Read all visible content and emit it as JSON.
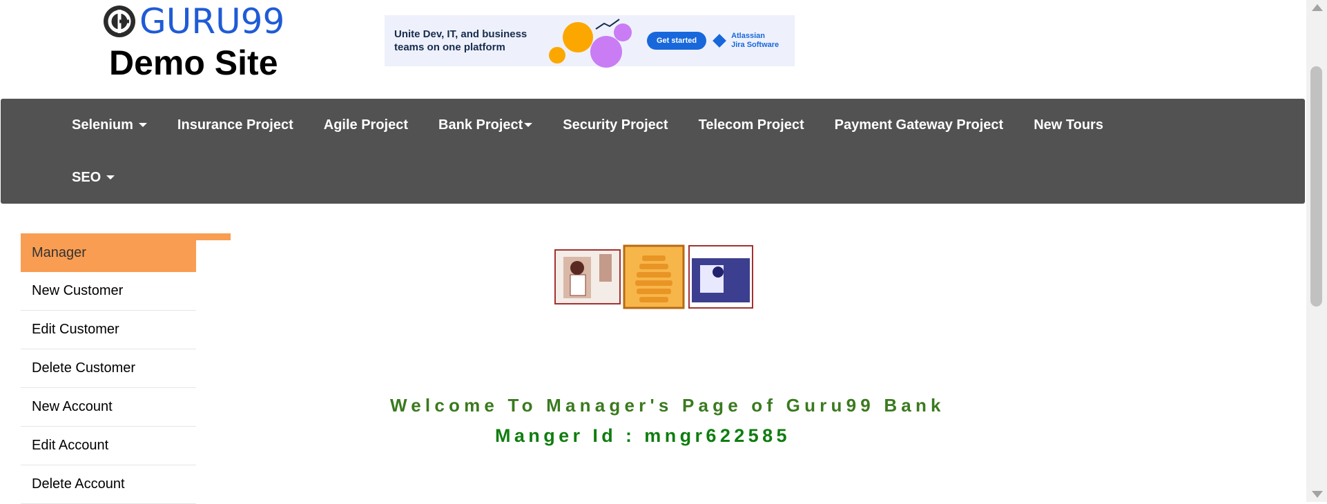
{
  "header": {
    "logo_text": "GURU99",
    "site_title": "Demo Site"
  },
  "ad": {
    "headline": "Unite Dev, IT, and business teams on one platform",
    "button_label": "Get started",
    "brand_line1": "Atlassian",
    "brand_line2": "Jira Software"
  },
  "nav": {
    "items": [
      {
        "label": "Selenium",
        "dropdown": true
      },
      {
        "label": "Insurance Project"
      },
      {
        "label": "Agile Project"
      },
      {
        "label": "Bank Project",
        "dropdown": true
      },
      {
        "label": "Security Project"
      },
      {
        "label": "Telecom Project"
      },
      {
        "label": "Payment Gateway Project"
      },
      {
        "label": "New Tours"
      },
      {
        "label": "SEO",
        "dropdown": true
      }
    ]
  },
  "sidebar": {
    "items": [
      {
        "label": "Manager",
        "active": true
      },
      {
        "label": "New Customer"
      },
      {
        "label": "Edit Customer"
      },
      {
        "label": "Delete Customer"
      },
      {
        "label": "New Account"
      },
      {
        "label": "Edit Account"
      },
      {
        "label": "Delete Account"
      }
    ]
  },
  "main": {
    "welcome_text": "Welcome To Manager's Page of Guru99 Bank",
    "manager_id_text": "Manger Id : mngr622585"
  },
  "colors": {
    "navbar_bg": "#525252",
    "accent_orange": "#f99d52",
    "welcome_green": "#3a7a1f",
    "manager_green": "#0f7d0f",
    "logo_blue": "#1f5bd6"
  }
}
